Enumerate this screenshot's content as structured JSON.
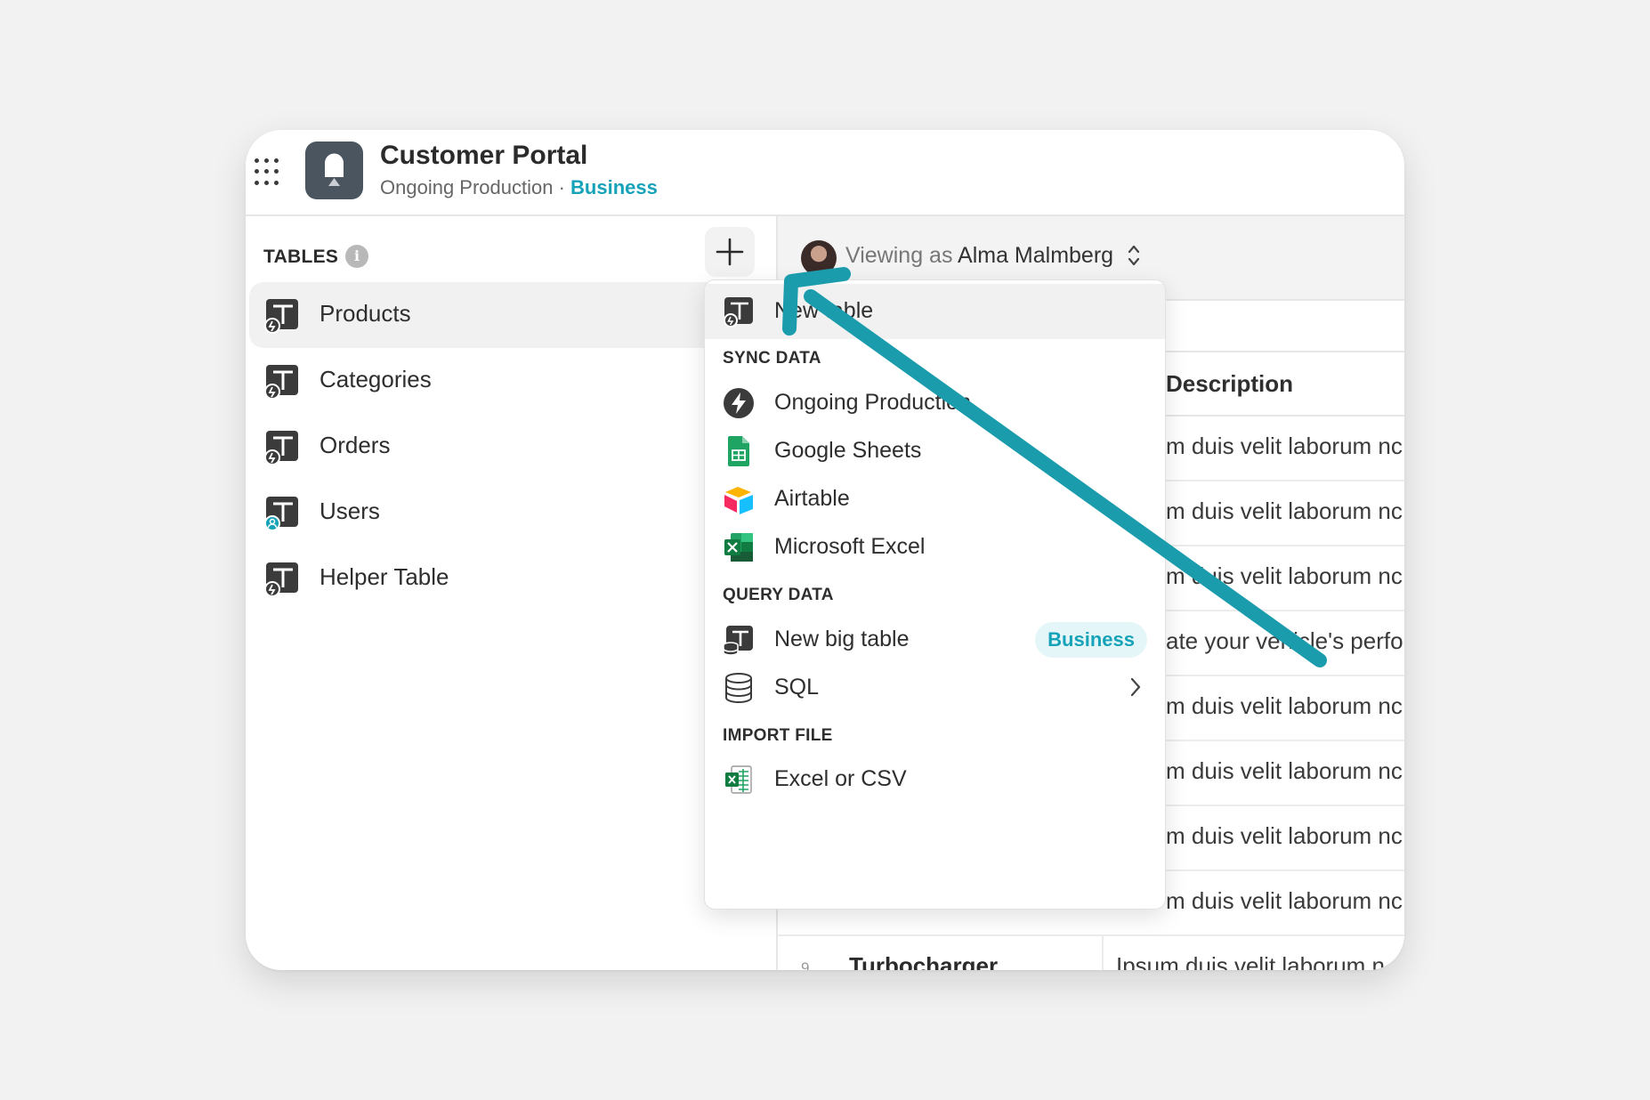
{
  "app": {
    "title": "Customer Portal",
    "subtitle_source": "Ongoing Production",
    "separator": " · ",
    "plan": "Business"
  },
  "sidebar": {
    "tables_label": "TABLES",
    "info": "i",
    "items": [
      {
        "label": "Products",
        "icon": "table-icon",
        "active": true
      },
      {
        "label": "Categories",
        "icon": "table-icon"
      },
      {
        "label": "Orders",
        "icon": "table-icon"
      },
      {
        "label": "Users",
        "icon": "user-table-icon"
      },
      {
        "label": "Helper Table",
        "icon": "table-icon"
      }
    ]
  },
  "viewbar": {
    "prefix": "Viewing as ",
    "user": "Alma Malmberg"
  },
  "table": {
    "column_description": "Description",
    "rows": [
      {
        "desc": "m duis velit laborum nc"
      },
      {
        "desc": "m duis velit laborum nc"
      },
      {
        "desc": "m duis velit laborum nc"
      },
      {
        "desc": "ate your vehicle's perfo"
      },
      {
        "desc": "m duis velit laborum nc"
      },
      {
        "desc": "m duis velit laborum nc"
      },
      {
        "desc": "m duis velit laborum nc"
      },
      {
        "desc": "m duis velit laborum nc"
      }
    ],
    "last_row": {
      "num": "9",
      "name": "Turbocharger",
      "desc": "Ipsum duis velit laborum n"
    }
  },
  "dropdown": {
    "new_table": "New table",
    "sync_label": "SYNC DATA",
    "sync": [
      {
        "label": "Ongoing Production",
        "icon": "bolt-icon"
      },
      {
        "label": "Google Sheets",
        "icon": "google-sheets-icon"
      },
      {
        "label": "Airtable",
        "icon": "airtable-icon"
      },
      {
        "label": "Microsoft Excel",
        "icon": "excel-icon"
      }
    ],
    "query_label": "QUERY DATA",
    "big_table": "New big table",
    "big_table_badge": "Business",
    "sql": "SQL",
    "import_label": "IMPORT FILE",
    "import_file": "Excel or CSV"
  },
  "colors": {
    "accent": "#16a2b8",
    "arrow": "#1a9cad"
  }
}
